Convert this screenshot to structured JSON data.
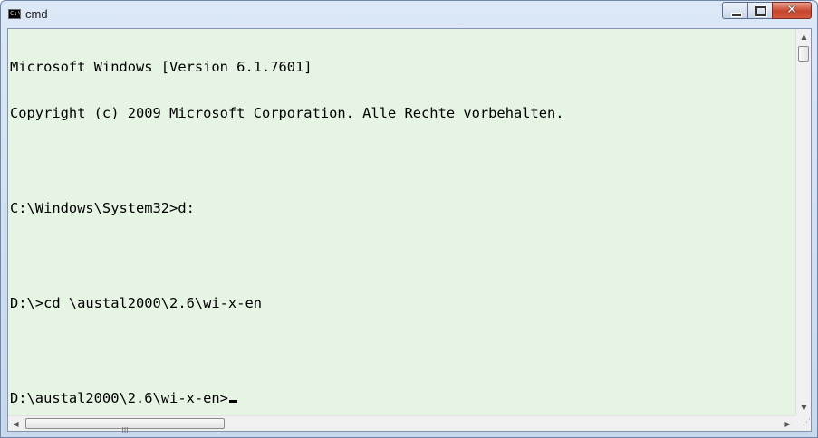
{
  "window": {
    "title": "cmd",
    "icon": "console-icon",
    "icon_text": "C:\\",
    "controls": {
      "minimize": "minimize-button",
      "maximize": "maximize-button",
      "close": "close-button",
      "close_glyph": "✕"
    }
  },
  "console": {
    "background_color": "#e6f4e3",
    "text_color": "#000000",
    "lines": [
      "Microsoft Windows [Version 6.1.7601]",
      "Copyright (c) 2009 Microsoft Corporation. Alle Rechte vorbehalten.",
      "",
      "C:\\Windows\\System32>d:",
      "",
      "D:\\>cd \\austal2000\\2.6\\wi-x-en",
      "",
      "D:\\austal2000\\2.6\\wi-x-en>"
    ]
  },
  "scrollbars": {
    "up_arrow": "▲",
    "down_arrow": "▼",
    "left_arrow": "◀",
    "right_arrow": "▶",
    "h_grip": "III",
    "size_grip": "⋰"
  }
}
